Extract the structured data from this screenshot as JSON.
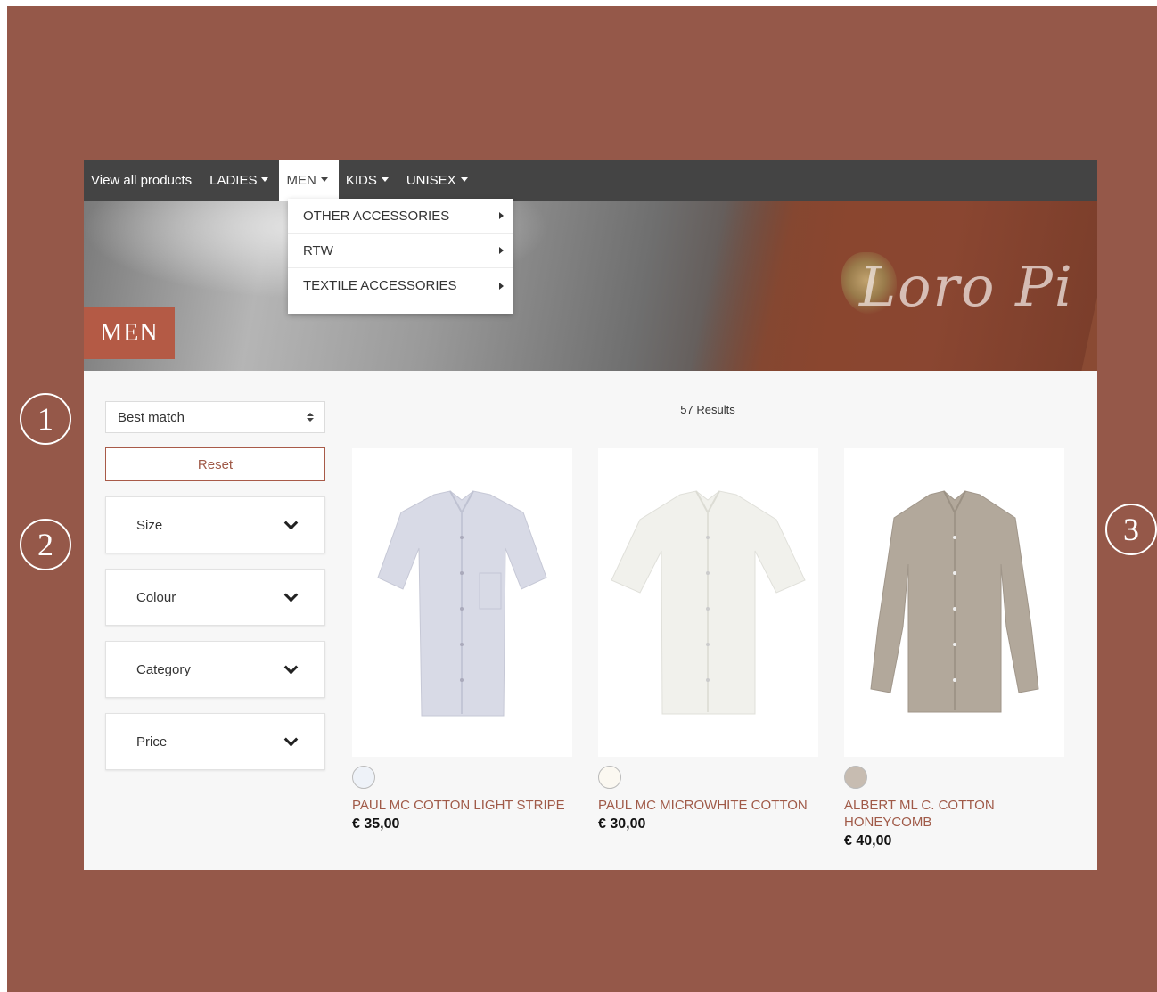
{
  "nav": {
    "items": [
      {
        "label": "View all products",
        "caret": false,
        "active": false
      },
      {
        "label": "LADIES",
        "caret": true,
        "active": false
      },
      {
        "label": "MEN",
        "caret": true,
        "active": true
      },
      {
        "label": "KIDS",
        "caret": true,
        "active": false
      },
      {
        "label": "UNISEX",
        "caret": true,
        "active": false
      }
    ]
  },
  "dropdown": {
    "items": [
      {
        "label": "OTHER ACCESSORIES"
      },
      {
        "label": "RTW"
      },
      {
        "label": "TEXTILE ACCESSORIES"
      }
    ]
  },
  "hero": {
    "badge": "MEN",
    "logo_text": "Loro Pi"
  },
  "sidebar": {
    "sort_value": "Best match",
    "reset_label": "Reset",
    "filters": [
      {
        "label": "Size"
      },
      {
        "label": "Colour"
      },
      {
        "label": "Category"
      },
      {
        "label": "Price"
      }
    ]
  },
  "results": {
    "count_label": "57 Results",
    "products": [
      {
        "name": "PAUL MC COTTON LIGHT STRIPE",
        "price": "€ 35,00",
        "swatch": "#eef2f8",
        "shirt": "#d8dae6",
        "sleeve": "short"
      },
      {
        "name": "PAUL MC MICROWHITE COTTON",
        "price": "€ 30,00",
        "swatch": "#fbf8f1",
        "shirt": "#f1f1ec",
        "sleeve": "short"
      },
      {
        "name": "ALBERT ML C. COTTON HONEYCOMB",
        "price": "€ 40,00",
        "swatch": "#c7bcb1",
        "shirt": "#b2a89b",
        "sleeve": "long"
      }
    ]
  },
  "annotations": [
    "1",
    "2",
    "3"
  ],
  "colors": {
    "frame": "#955849",
    "nav": "#444444",
    "accent": "#a05a48",
    "badge": "#b45a45"
  }
}
